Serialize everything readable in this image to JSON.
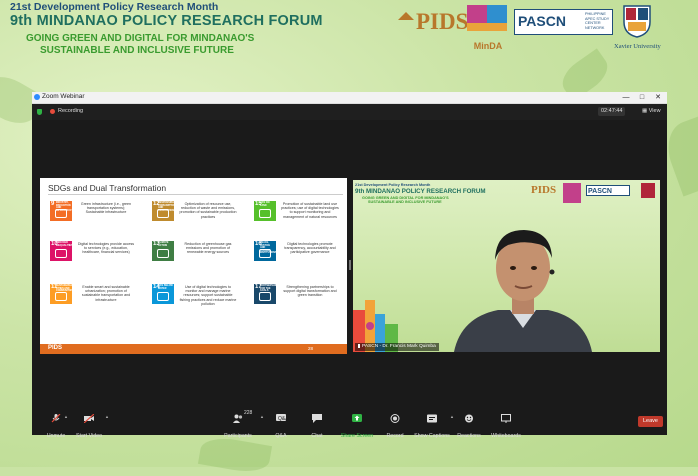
{
  "banner": {
    "line1": "21st Development Policy Research Month",
    "line2": "9th MINDANAO POLICY RESEARCH FORUM",
    "line3": "GOING GREEN AND DIGITAL FOR MINDANAO'S",
    "line4": "SUSTAINABLE AND INCLUSIVE FUTURE",
    "logos": {
      "pids": "PIDS",
      "minda": "MinDA",
      "pascn": "PASCN",
      "pascn_sub": "PHILIPPINE APEC STUDY CENTER NETWORK",
      "xu": "Xavier University"
    }
  },
  "zoom": {
    "window_title": "Zoom Webinar",
    "recording_label": "Recording",
    "timer": "02:47:44",
    "view_label": "View",
    "slide": {
      "title": "SDGs and Dual Transformation",
      "page_number": "28",
      "footer_logo": "PIDS",
      "sdgs": [
        {
          "num": "9",
          "label": "INDUSTRY, INNOVATION AND INFRASTRUCTURE",
          "color": "#f36d25",
          "desc": "Green infrastructure (i.e., green transportation systems); Sustainable infrastructure"
        },
        {
          "num": "12",
          "label": "RESPONSIBLE CONSUMPTION AND PRODUCTION",
          "color": "#bf8b2e",
          "desc": "Optimization of resource use, reduction of waste and emissions, promotion of sustainable production practices"
        },
        {
          "num": "15",
          "label": "LIFE ON LAND",
          "color": "#56c02b",
          "desc": "Promotion of sustainable land use practices; use of digital technologies to support monitoring and management of natural resources"
        },
        {
          "num": "10",
          "label": "REDUCED INEQUALITIES",
          "color": "#dd1367",
          "desc": "Digital technologies provide access to services (e.g., education, healthcare, financial services)"
        },
        {
          "num": "13",
          "label": "CLIMATE ACTION",
          "color": "#3f7e44",
          "desc": "Reduction of greenhouse gas emissions and promotion of renewable energy sources"
        },
        {
          "num": "16",
          "label": "PEACE, JUSTICE AND STRONG INSTITUTIONS",
          "color": "#00689d",
          "desc": "Digital technologies promote transparency, accountability and participative governance"
        },
        {
          "num": "11",
          "label": "SUSTAINABLE CITIES AND COMMUNITIES",
          "color": "#fd9d24",
          "desc": "Enable smart and sustainable urbanization; promotion of sustainable transportation and infrastructure"
        },
        {
          "num": "14",
          "label": "LIFE BELOW WATER",
          "color": "#0a97d9",
          "desc": "Use of digital technologies to monitor and manage marine resources; support sustainable fishing practices and reduce marine pollution"
        },
        {
          "num": "17",
          "label": "PARTNERSHIPS FOR THE GOALS",
          "color": "#19486a",
          "desc": "Strengthening partnerships to support digital transformation and green transition"
        }
      ]
    },
    "video": {
      "name_tag": "PASCN - Dr. Francis Mark Quimba",
      "bg_line1": "21st Development Policy Research Month",
      "bg_line2": "9th MINDANAO POLICY RESEARCH FORUM",
      "bg_line3": "GOING GREEN AND DIGITAL FOR MINDANAO'S",
      "bg_line4": "SUSTAINABLE AND INCLUSIVE FUTURE",
      "bg_pids": "PIDS",
      "bg_pascn": "PASCN"
    },
    "toolbar": {
      "unmute": "Unmute",
      "start_video": "Start Video",
      "participants": "Participants",
      "participants_count": "228",
      "qa": "Q&A",
      "chat": "Chat",
      "share_screen": "Share Screen",
      "record": "Record",
      "show_captions": "Show Captions",
      "reactions": "Reactions",
      "whiteboards": "Whiteboards",
      "leave": "Leave"
    }
  }
}
